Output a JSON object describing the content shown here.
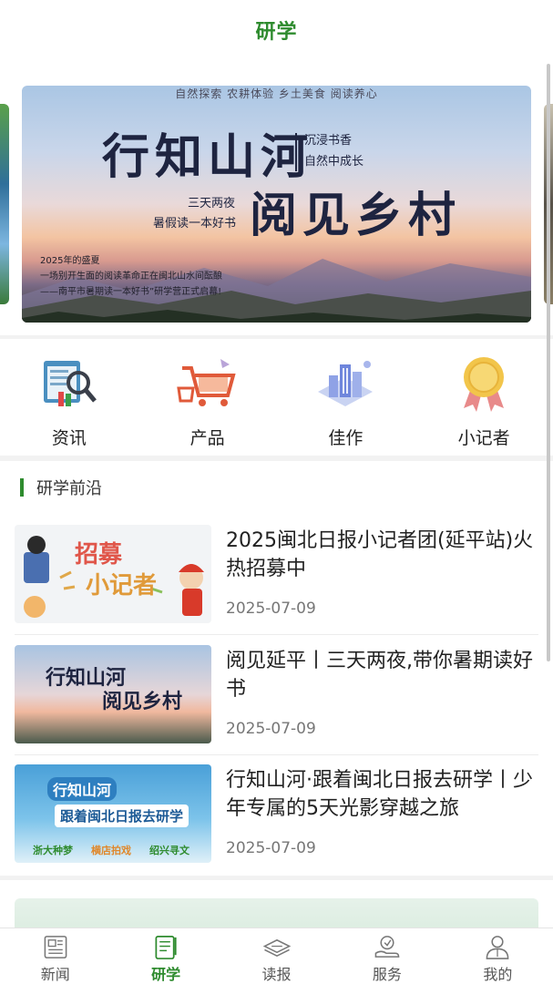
{
  "header": {
    "title": "研学"
  },
  "banner": {
    "top_line": "自然探索  农耕体验  乡土美食  阅读养心",
    "title_1": "行知山河",
    "side_1": "沉浸书香",
    "side_2": "自然中成长",
    "title_2": "阅见乡村",
    "mid_1": "三天两夜",
    "mid_2": "暑假读一本好书",
    "bottom_1": "2025年的盛夏",
    "bottom_2": "一场别开生面的阅读革命正在闽北山水间酝酿",
    "bottom_3": "——南平市暑期读一本好书”研学营正式启幕!"
  },
  "categories": [
    {
      "label": "资讯",
      "icon": "news-search-icon"
    },
    {
      "label": "产品",
      "icon": "shopping-cart-icon"
    },
    {
      "label": "佳作",
      "icon": "city-buildings-icon"
    },
    {
      "label": "小记者",
      "icon": "medal-icon"
    }
  ],
  "section": {
    "title": "研学前沿",
    "items": [
      {
        "title": "2025闽北日报小记者团(延平站)火热招募中",
        "date": "2025-07-09",
        "thumb_text_1": "招募",
        "thumb_text_2": "小记者"
      },
      {
        "title": "阅见延平丨三天两夜,带你暑期读好书",
        "date": "2025-07-09",
        "thumb_text_1": "行知山河",
        "thumb_text_2": "阅见乡村"
      },
      {
        "title": "行知山河·跟着闽北日报去研学丨少年专属的5天光影穿越之旅",
        "date": "2025-07-09",
        "thumb_text_1": "行知山河",
        "thumb_text_2": "跟着闽北日报去研学",
        "thumb_tag_1": "浙大种梦",
        "thumb_tag_2": "横店拍戏",
        "thumb_tag_3": "绍兴寻文"
      }
    ]
  },
  "tabbar": {
    "items": [
      {
        "label": "新闻",
        "icon": "newspaper-icon",
        "active": false
      },
      {
        "label": "研学",
        "icon": "study-notebook-icon",
        "active": true
      },
      {
        "label": "读报",
        "icon": "read-paper-icon",
        "active": false
      },
      {
        "label": "服务",
        "icon": "service-hand-icon",
        "active": false
      },
      {
        "label": "我的",
        "icon": "profile-person-icon",
        "active": false
      }
    ]
  },
  "colors": {
    "accent": "#2e8b2e",
    "text": "#222222",
    "muted": "#777777"
  }
}
